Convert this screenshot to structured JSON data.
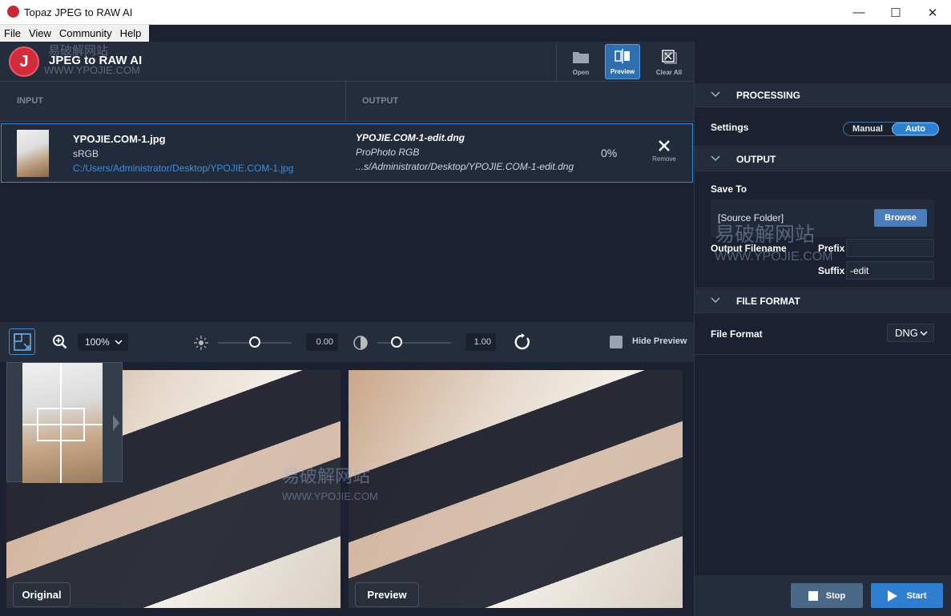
{
  "window": {
    "title": "Topaz JPEG to RAW AI",
    "minimize": "—",
    "maximize": "☐",
    "close": "✕"
  },
  "menu": [
    "File",
    "View",
    "Community",
    "Help"
  ],
  "app": {
    "logo_letter": "J",
    "title": "JPEG to RAW AI",
    "watermark_cn": "易破解网站",
    "watermark_en": "WWW.YPOJIE.COM"
  },
  "toolbar": {
    "open": "Open",
    "preview": "Preview",
    "clear_all": "Clear All"
  },
  "columns": {
    "input": "INPUT",
    "output": "OUTPUT"
  },
  "file": {
    "input_name": "YPOJIE.COM-1.jpg",
    "input_colorspace": "sRGB",
    "input_path": "C:/Users/Administrator/Desktop/YPOJIE.COM-1.jpg",
    "output_name": "YPOJIE.COM-1-edit.dng",
    "output_colorspace": "ProPhoto RGB",
    "output_path": "...s/Administrator/Desktop/YPOJIE.COM-1-edit.dng",
    "progress": "0%",
    "remove_label": "Remove"
  },
  "viewer": {
    "zoom": "100%",
    "exposure": "0.00",
    "contrast": "1.00",
    "hide_preview": "Hide Preview",
    "original_label": "Original",
    "preview_label": "Preview"
  },
  "panel": {
    "processing": {
      "title": "PROCESSING",
      "settings_label": "Settings",
      "manual": "Manual",
      "auto": "Auto"
    },
    "output": {
      "title": "OUTPUT",
      "save_to": "Save To",
      "folder": "[Source Folder]",
      "browse": "Browse",
      "filename_label": "Output Filename",
      "prefix_label": "Prefix",
      "prefix_value": "",
      "suffix_label": "Suffix",
      "suffix_value": "-edit"
    },
    "file_format": {
      "title": "FILE FORMAT",
      "label": "File Format",
      "value": "DNG"
    }
  },
  "actions": {
    "stop": "Stop",
    "start": "Start"
  },
  "colors": {
    "accent": "#2f7fd1",
    "background": "#1b2130",
    "panel": "#252d3d",
    "logo_red": "#d12c3c"
  }
}
